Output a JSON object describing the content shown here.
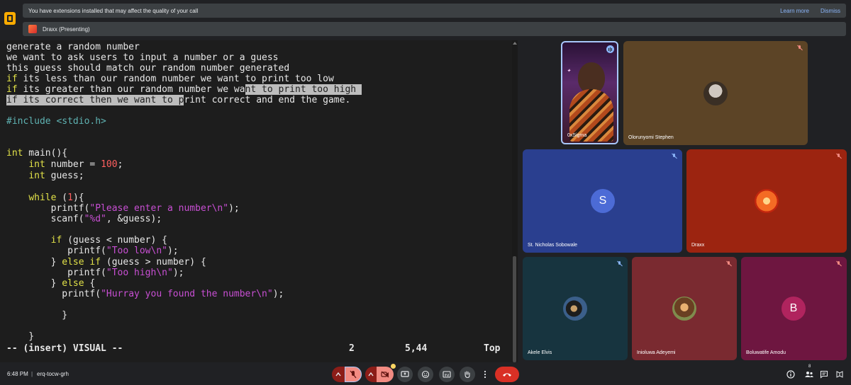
{
  "banner": {
    "message": "You have extensions installed that may affect the quality of your call",
    "learn_more": "Learn more",
    "dismiss": "Dismiss"
  },
  "presenting": {
    "label": "Draxx (Presenting)"
  },
  "editor": {
    "lines": [
      "generate a random number",
      "we want to ask users to input a number or a guess",
      "this guess should match our random number generated",
      "if its less than our random number we want to print too low",
      "if its greater than our random number we want to print too high",
      "if its correct then we want to print correct and end the game.",
      "",
      "#include <stdio.h>",
      "",
      "",
      "int main(){",
      "    int number = 100;",
      "    int guess;",
      "",
      "    while (1){",
      "        printf(\"Please enter a number\\n\");",
      "        scanf(\"%d\", &guess);",
      "",
      "        if (guess < number) {",
      "           printf(\"Too low\\n\");",
      "        } else if (guess > number) {",
      "           printf(\"Too high\\n\");",
      "        } else {",
      "          printf(\"Hurray you found the number\\n\");",
      "",
      "          }",
      "",
      "    }"
    ],
    "status": {
      "mode": "-- (insert) VISUAL --",
      "count": "2",
      "position": "5,44",
      "scroll": "Top"
    }
  },
  "participants": [
    {
      "name": "0xSigma",
      "type": "video"
    },
    {
      "name": "Olorunyomi Stephen",
      "type": "photo"
    },
    {
      "name": "St. Nicholas Sobowale",
      "type": "letter",
      "letter": "S",
      "avatar_color": "#4c6bd6"
    },
    {
      "name": "Draxx",
      "type": "photo"
    },
    {
      "name": "Akele Elvis",
      "type": "photo"
    },
    {
      "name": "Inioluwa Adeyemi",
      "type": "photo"
    },
    {
      "name": "Boluwatife Amodu",
      "type": "letter",
      "letter": "B",
      "avatar_color": "#b0245e"
    }
  ],
  "bottom": {
    "time": "6:48 PM",
    "separator": "|",
    "meeting_code": "erq-tocw-grh",
    "people_count": "8"
  },
  "colors": {
    "accent": "#8ab4f8",
    "danger": "#d93025"
  }
}
